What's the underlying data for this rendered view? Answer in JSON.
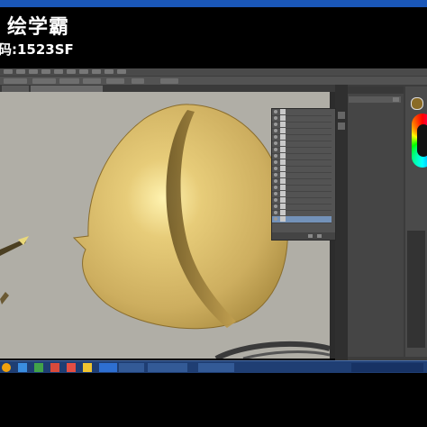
{
  "banner": {
    "brand": "绘学霸",
    "code": "码:1523SF"
  },
  "canvas": {
    "subject": "golden-egg-sketch"
  },
  "colors": {
    "egg_light": "#f3dc86",
    "egg_mid": "#d8b863",
    "egg_dark": "#9c7d35",
    "canvas_bg": "#b0aea6",
    "taskbar": "#1f3e73"
  },
  "layers_panel": {
    "rows": 18,
    "selected_index": 17
  },
  "taskbar": {
    "items": [
      "start",
      "ie",
      "folder",
      "media",
      "chrome",
      "ps",
      "window1",
      "window2",
      "window3"
    ]
  }
}
